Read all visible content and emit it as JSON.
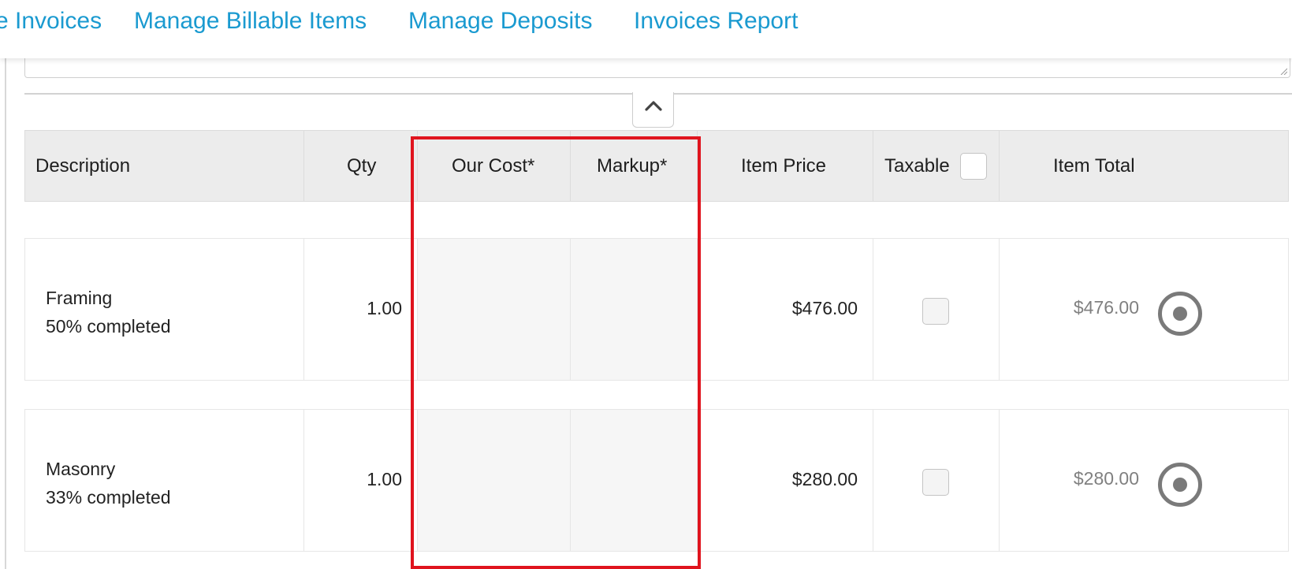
{
  "nav": {
    "items": [
      {
        "label": "e Invoices"
      },
      {
        "label": "Manage Billable Items"
      },
      {
        "label": "Manage Deposits"
      },
      {
        "label": "Invoices Report"
      }
    ]
  },
  "table": {
    "headers": {
      "description": "Description",
      "qty": "Qty",
      "our_cost": "Our Cost*",
      "markup": "Markup*",
      "item_price": "Item Price",
      "taxable": "Taxable",
      "item_total": "Item Total"
    },
    "rows": [
      {
        "name": "Framing",
        "status": "50% completed",
        "qty": "1.00",
        "our_cost": "",
        "markup": "",
        "item_price": "$476.00",
        "taxable": false,
        "item_total": "$476.00"
      },
      {
        "name": "Masonry",
        "status": "33% completed",
        "qty": "1.00",
        "our_cost": "",
        "markup": "",
        "item_price": "$280.00",
        "taxable": false,
        "item_total": "$280.00"
      }
    ]
  },
  "icons": {
    "collapse": "chevron-up-icon",
    "row_action": "radio-target-icon"
  },
  "colors": {
    "link": "#1a9ad0",
    "highlight": "#e0141e",
    "header_bg": "#ececec",
    "muted_total": "#808080"
  }
}
